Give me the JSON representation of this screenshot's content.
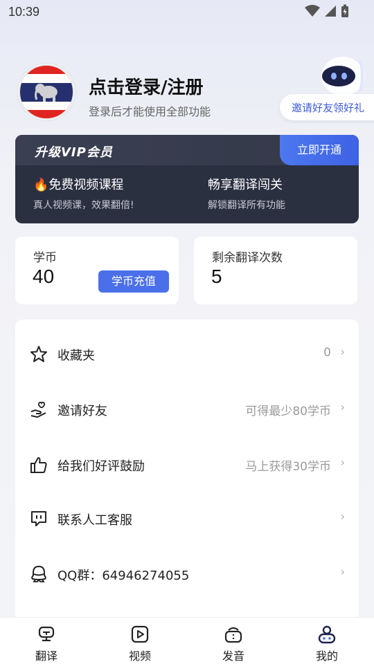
{
  "status": {
    "time": "10:39"
  },
  "profile": {
    "title": "点击登录/注册",
    "subtitle": "登录后才能使用全部功能"
  },
  "invite_pill": "邀请好友领好礼",
  "vip": {
    "title": "升级VIP会员",
    "open_label": "立即开通",
    "features": [
      {
        "title": "🔥免费视频课程",
        "desc": "真人视频课，效果翻倍!"
      },
      {
        "title": "畅享翻译闯关",
        "desc": "解锁翻译所有功能"
      }
    ]
  },
  "stats": {
    "coins": {
      "label": "学币",
      "value": "40",
      "button": "学币充值"
    },
    "translations": {
      "label": "剩余翻译次数",
      "value": "5"
    }
  },
  "menu": [
    {
      "icon": "star-icon",
      "label": "收藏夹",
      "value": "0"
    },
    {
      "icon": "hand-heart-icon",
      "label": "邀请好友",
      "value": "可得最少80学币"
    },
    {
      "icon": "thumbs-up-icon",
      "label": "给我们好评鼓励",
      "value": "马上获得30学币"
    },
    {
      "icon": "chat-bubble-icon",
      "label": "联系人工客服",
      "value": ""
    },
    {
      "icon": "qq-icon",
      "label": "QQ群：64946274055",
      "value": ""
    }
  ],
  "tabs": [
    {
      "icon": "translate-icon",
      "label": "翻译"
    },
    {
      "icon": "video-icon",
      "label": "视频"
    },
    {
      "icon": "pronunciation-icon",
      "label": "发音"
    },
    {
      "icon": "profile-icon",
      "label": "我的"
    }
  ],
  "colors": {
    "accent": "#4a6fe8",
    "vip_bg": "#2b3041",
    "invite_text": "#3c5bd8"
  }
}
